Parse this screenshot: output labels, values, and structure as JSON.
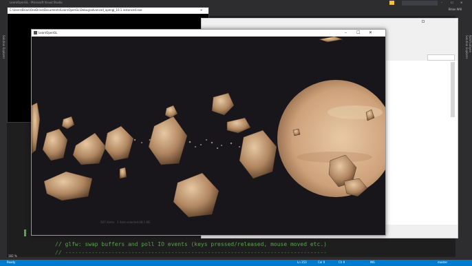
{
  "vs": {
    "title_left": "LearnOpenGL - Microsoft Visual Studio",
    "quick_launch": "Quick Launch (Ctrl+Q)",
    "user": "Brian Will",
    "left_tab": "Solution Explorer",
    "right_tabs": [
      "Solution Explorer",
      "Notifications"
    ],
    "zoom": "182 %",
    "status": {
      "ready": "Ready",
      "ln": "Ln 353",
      "col": "Col 9",
      "ch": "Ch 9",
      "ins": "INS",
      "branch": "master"
    }
  },
  "console": {
    "title": "C:\\Users\\Brian\\OneDrive\\Documents\\LearnOpenGL\\Debug\\advanced_opengl_10.1.instanced.exe"
  },
  "explorer": {
    "search_placeholder": "Search Do...",
    "items_count": "567 items",
    "selected": "1 item selected 48.1 KB"
  },
  "gl_window": {
    "title": "LearnOpenGL",
    "controls": [
      "–",
      "☐",
      "✕"
    ]
  },
  "editor": {
    "code_lines": [
      "// glfw: swap buffers and poll IO events (keys pressed/released, mouse moved etc.)",
      "// -------------------------------------------------------------------------------"
    ]
  },
  "colors": {
    "vs_dark": "#2d2d30",
    "vs_blue": "#007acc",
    "comment_green": "#57a64a",
    "space": "#18161a",
    "planet": "#d9b28c"
  }
}
